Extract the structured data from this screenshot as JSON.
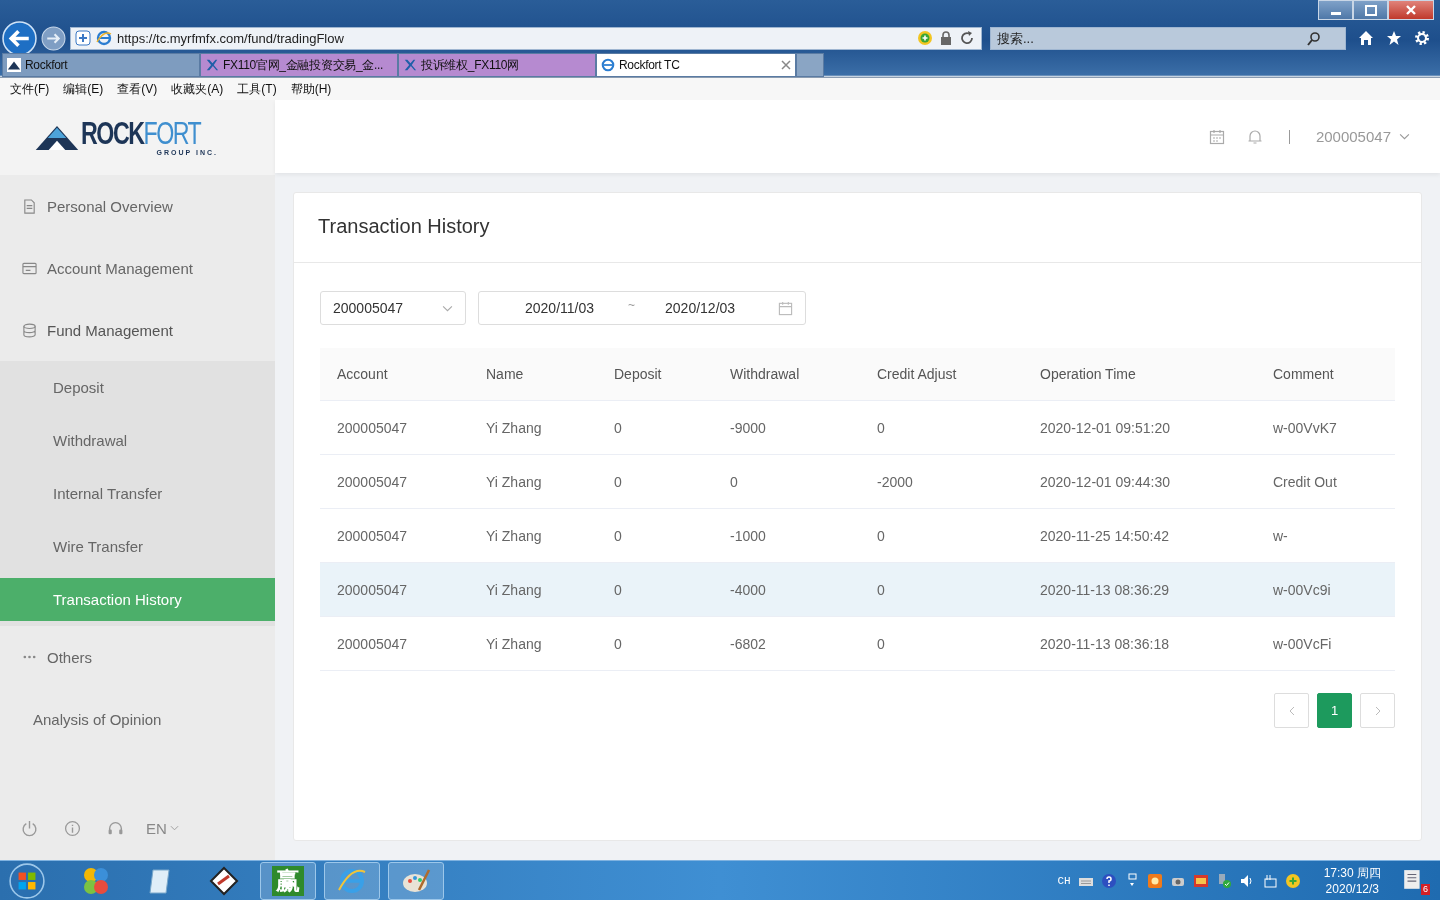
{
  "browser": {
    "url": "https://tc.myrfmfx.com/fund/tradingFlow",
    "search_placeholder": "搜索...",
    "tabs": [
      {
        "label": "Rockfort",
        "selected": false,
        "kind": "rockfort"
      },
      {
        "label": "FX110官网_金融投资交易_金...",
        "selected": false,
        "kind": "fx"
      },
      {
        "label": "投诉维权_FX110网",
        "selected": false,
        "kind": "fx"
      },
      {
        "label": "Rockfort TC",
        "selected": true,
        "kind": "ie"
      }
    ],
    "menu": [
      "文件(F)",
      "编辑(E)",
      "查看(V)",
      "收藏夹(A)",
      "工具(T)",
      "帮助(H)"
    ]
  },
  "logo": {
    "text_dark": "ROCK",
    "text_light": "FORT",
    "tagline": "GROUP INC."
  },
  "header": {
    "account": "200005047"
  },
  "sidebar": {
    "items": [
      {
        "label": "Personal Overview",
        "kind": "doc"
      },
      {
        "label": "Account Management",
        "kind": "card"
      },
      {
        "label": "Fund Management",
        "kind": "db",
        "expanded": true,
        "children": [
          {
            "label": "Deposit",
            "selected": false
          },
          {
            "label": "Withdrawal",
            "selected": false
          },
          {
            "label": "Internal Transfer",
            "selected": false
          },
          {
            "label": "Wire Transfer",
            "selected": false
          },
          {
            "label": "Transaction History",
            "selected": true
          }
        ]
      },
      {
        "label": "Others",
        "kind": "dots"
      },
      {
        "label": "Analysis of Opinion",
        "kind": "none"
      }
    ],
    "language": "EN"
  },
  "main": {
    "title": "Transaction History",
    "account_select": "200005047",
    "date_from": "2020/11/03",
    "date_separator": "~",
    "date_to": "2020/12/03",
    "table": {
      "columns": [
        "Account",
        "Name",
        "Deposit",
        "Withdrawal",
        "Credit Adjust",
        "Operation Time",
        "Comment"
      ],
      "rows": [
        {
          "hovered": false,
          "cells": [
            "200005047",
            "Yi Zhang",
            "0",
            "-9000",
            "0",
            "2020-12-01 09:51:20",
            "w-00VvK7"
          ]
        },
        {
          "hovered": false,
          "cells": [
            "200005047",
            "Yi Zhang",
            "0",
            "0",
            "-2000",
            "2020-12-01 09:44:30",
            "Credit Out"
          ]
        },
        {
          "hovered": false,
          "cells": [
            "200005047",
            "Yi Zhang",
            "0",
            "-1000",
            "0",
            "2020-11-25 14:50:42",
            "w-"
          ]
        },
        {
          "hovered": true,
          "cells": [
            "200005047",
            "Yi Zhang",
            "0",
            "-4000",
            "0",
            "2020-11-13 08:36:29",
            "w-00Vc9i"
          ]
        },
        {
          "hovered": false,
          "cells": [
            "200005047",
            "Yi Zhang",
            "0",
            "-6802",
            "0",
            "2020-11-13 08:36:18",
            "w-00VcFi"
          ]
        }
      ]
    },
    "pages": [
      {
        "label": "1",
        "selected": true
      }
    ]
  },
  "taskbar": {
    "app_glyph": "赢",
    "ime": "CH",
    "time": "17:30 周四",
    "date": "2020/12/3",
    "badge": "6"
  }
}
